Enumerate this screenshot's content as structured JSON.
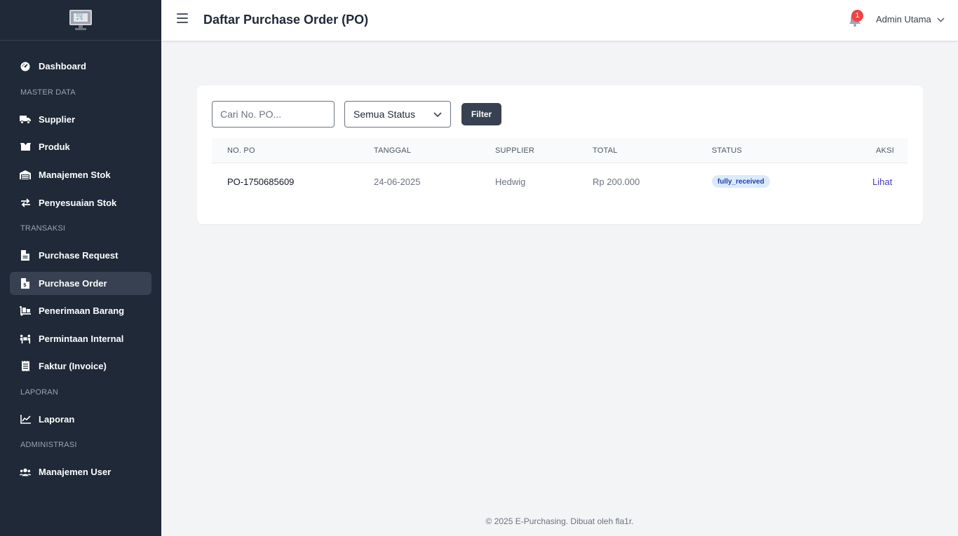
{
  "header": {
    "title": "Daftar Purchase Order (PO)",
    "notification_count": "1",
    "user_name": "Admin Utama"
  },
  "sidebar": {
    "items": [
      {
        "label": "Dashboard",
        "icon": "gauge-icon"
      },
      {
        "label": "Supplier",
        "icon": "truck-icon"
      },
      {
        "label": "Produk",
        "icon": "box-icon"
      },
      {
        "label": "Manajemen Stok",
        "icon": "warehouse-icon"
      },
      {
        "label": "Penyesuaian Stok",
        "icon": "exchange-icon"
      },
      {
        "label": "Purchase Request",
        "icon": "file-icon"
      },
      {
        "label": "Purchase Order",
        "icon": "file-invoice-icon",
        "active": true
      },
      {
        "label": "Penerimaan Barang",
        "icon": "dolly-icon"
      },
      {
        "label": "Permintaan Internal",
        "icon": "people-carry-icon"
      },
      {
        "label": "Faktur (Invoice)",
        "icon": "receipt-icon"
      },
      {
        "label": "Laporan",
        "icon": "chart-line-icon"
      },
      {
        "label": "Manajemen User",
        "icon": "users-icon"
      }
    ],
    "sections": [
      "MASTER DATA",
      "TRANSAKSI",
      "LAPORAN",
      "ADMINISTRASI"
    ]
  },
  "filters": {
    "search_placeholder": "Cari No. PO...",
    "status_selected": "Semua Status",
    "filter_label": "Filter"
  },
  "table": {
    "columns": [
      "NO. PO",
      "TANGGAL",
      "SUPPLIER",
      "TOTAL",
      "STATUS",
      "AKSI"
    ],
    "rows": [
      {
        "po": "PO-1750685609",
        "date": "24-06-2025",
        "supplier": "Hedwig",
        "total": "Rp 200.000",
        "status": "fully_received",
        "action": "Lihat"
      }
    ]
  },
  "footer": {
    "text": "© 2025 E-Purchasing. Dibuat oleh fla1r."
  },
  "colors": {
    "sidebar_bg": "#1f2937",
    "active_item_bg": "#374151",
    "badge_bg": "#dbeafe",
    "badge_text": "#1e40af",
    "link": "#4338ca",
    "notification": "#ef4444"
  }
}
